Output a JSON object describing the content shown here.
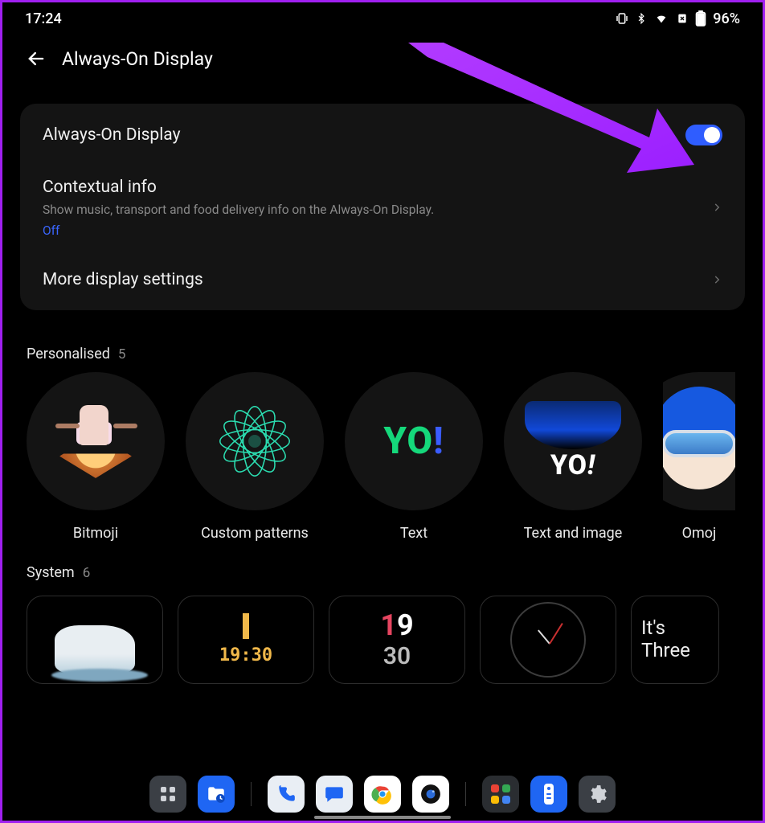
{
  "statusbar": {
    "time": "17:24",
    "battery_percent": "96%"
  },
  "header": {
    "title": "Always-On Display"
  },
  "card": {
    "aod_toggle_label": "Always-On Display",
    "aod_toggle_on": true,
    "contextual_title": "Contextual info",
    "contextual_sub": "Show music, transport and food delivery info on the Always-On Display.",
    "contextual_status": "Off",
    "more_label": "More display settings"
  },
  "sections": {
    "personalised": {
      "title": "Personalised",
      "count": "5"
    },
    "system": {
      "title": "System",
      "count": "6"
    }
  },
  "personalised_tiles": [
    {
      "label": "Bitmoji"
    },
    {
      "label": "Custom patterns"
    },
    {
      "label": "Text"
    },
    {
      "label": "Text and image"
    },
    {
      "label": "Omoj"
    }
  ],
  "tile_text": {
    "yo": "YO",
    "excl": "!"
  },
  "system_previews": {
    "digital_time": "19:30",
    "num_clock_top_a": "1",
    "num_clock_top_b": "9",
    "num_clock_bot": "30",
    "text_clock_l1": "It's",
    "text_clock_l2": "Three"
  },
  "dock": {
    "apps": [
      "app-drawer",
      "files",
      "phone",
      "messages",
      "chrome",
      "camera",
      "app-folder",
      "remote",
      "settings"
    ]
  }
}
